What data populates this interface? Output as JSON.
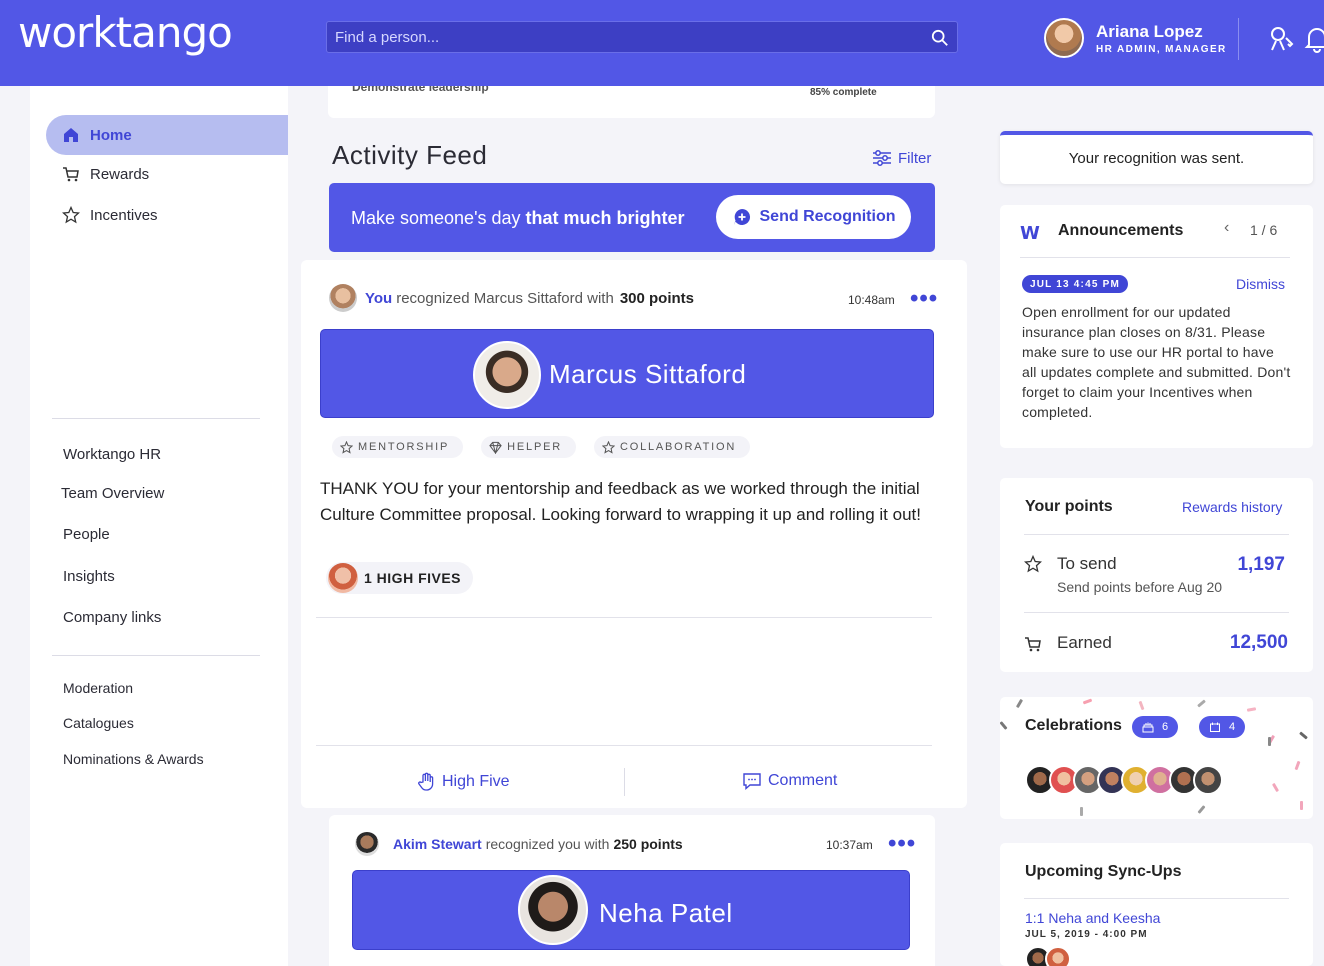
{
  "brand": {
    "logo_text": "worktango",
    "accent": "#5257e6"
  },
  "header": {
    "search_placeholder": "Find a person...",
    "user_name": "Ariana Lopez",
    "user_role": "HR ADMIN, MANAGER"
  },
  "sidebar": {
    "main": [
      {
        "label": "Home",
        "icon": "home-icon",
        "active": true
      },
      {
        "label": "Rewards",
        "icon": "cart-icon"
      },
      {
        "label": "Incentives",
        "icon": "star-icon"
      }
    ],
    "section2": [
      "Worktango HR",
      "Team Overview",
      "People",
      "Insights",
      "Company links"
    ],
    "section3": [
      "Moderation",
      "Catalogues",
      "Nominations & Awards"
    ]
  },
  "goal": {
    "label": "Demonstrate leadership",
    "progress_text": "85% complete",
    "progress": 0.85
  },
  "feed": {
    "title": "Activity Feed",
    "filter_label": "Filter",
    "banner": {
      "text_plain": "Make someone's day ",
      "text_bold": "that much brighter",
      "button_label": "Send Recognition"
    },
    "post1": {
      "actor": "You",
      "action": "recognized Marcus Sittaford with",
      "points": "300 points",
      "time": "10:48am",
      "recipient": "Marcus Sittaford",
      "tags": [
        "MENTORSHIP",
        "HELPER",
        "COLLABORATION"
      ],
      "message": "THANK YOU for your mentorship and feedback as we worked through the initial Culture Committee proposal. Looking forward to wrapping it up and rolling it out!",
      "high_fives": "1  HIGH FIVES",
      "actions": {
        "high_five": "High Five",
        "comment": "Comment"
      }
    },
    "post2": {
      "actor": "Akim Stewart",
      "action": "recognized you with",
      "points": "250 points",
      "time": "10:37am",
      "recipient": "Neha Patel"
    }
  },
  "toast": {
    "text": "Your recognition was sent."
  },
  "announcements": {
    "logo": "W",
    "title": "Announcements",
    "counter": "1 / 6",
    "date_chip": "JUL 13  4:45 PM",
    "dismiss_label": "Dismiss",
    "body": "Open enrollment for our updated insurance plan closes on 8/31.  Please make sure to use our HR portal to have all updates complete and submitted. Don't forget to claim your Incentives when completed."
  },
  "points": {
    "title": "Your points",
    "history_link": "Rewards history",
    "to_send_label": "To send",
    "to_send_value": "1,197",
    "to_send_sub": "Send points before Aug 20",
    "earned_label": "Earned",
    "earned_value": "12,500"
  },
  "celebrations": {
    "title": "Celebrations",
    "birthdays_count": "6",
    "anniversaries_count": "4"
  },
  "syncups": {
    "title": "Upcoming Sync-Ups",
    "item_link": "1:1 Neha and Keesha",
    "item_date": "JUL 5, 2019 - 4:00 PM"
  }
}
